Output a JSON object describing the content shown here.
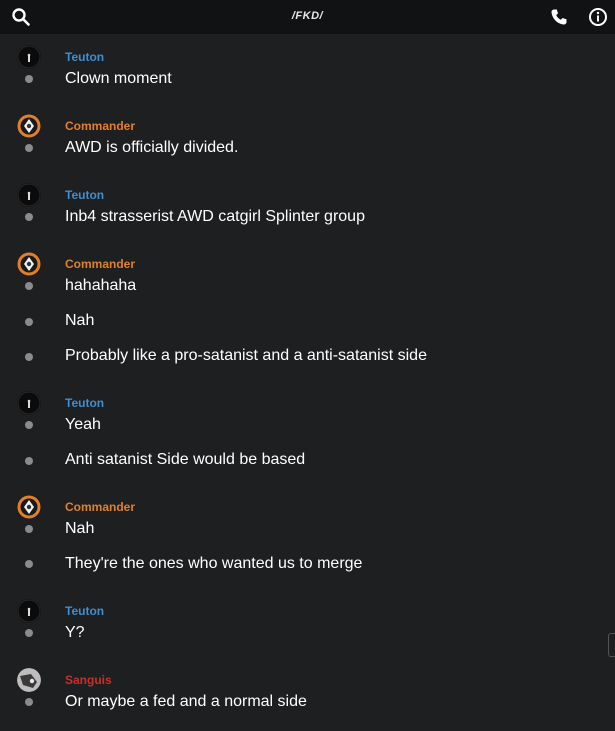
{
  "header": {
    "title": "/FKD/",
    "search_icon": "search-icon",
    "call_icon": "phone-icon",
    "info_icon": "info-icon"
  },
  "colors": {
    "background": "#1e1f21",
    "topbar": "#111214",
    "teuton": "#3d8fd1",
    "commander": "#e0802a",
    "sanguis": "#cc2d2d",
    "bullet": "#8a8b8d"
  },
  "messages": [
    {
      "user": "Teuton",
      "text": "Clown moment"
    },
    {
      "user": "Commander",
      "text": "AWD is officially divided."
    },
    {
      "user": "Teuton",
      "text": "Inb4 strasserist AWD catgirl Splinter group"
    },
    {
      "user": "Commander",
      "text": "hahahaha"
    },
    {
      "text": "Nah"
    },
    {
      "text": "Probably like a pro-satanist and a anti-satanist side"
    },
    {
      "user": "Teuton",
      "text": "Yeah"
    },
    {
      "text": "Anti satanist Side would be based"
    },
    {
      "user": "Commander",
      "text": "Nah"
    },
    {
      "text": "They're the ones who wanted us to merge"
    },
    {
      "user": "Teuton",
      "text": "Y?"
    },
    {
      "user": "Sanguis",
      "text": "Or maybe a fed and a normal side"
    }
  ]
}
